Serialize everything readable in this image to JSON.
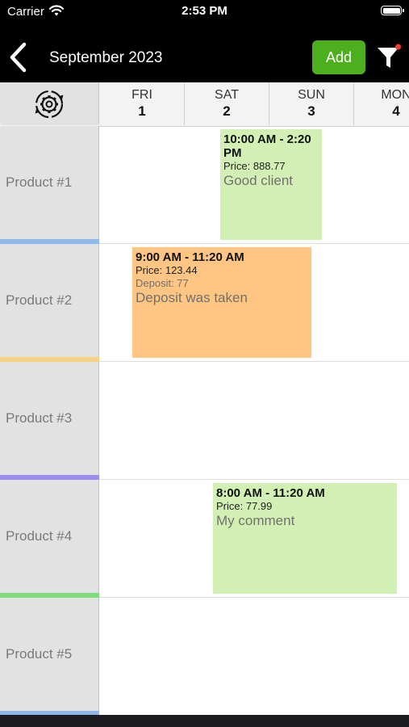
{
  "status_bar": {
    "carrier": "Carrier",
    "time": "2:53 PM"
  },
  "nav": {
    "title": "September 2023",
    "add_label": "Add",
    "back_icon": "chevron-left-icon",
    "filter_icon": "filter-icon"
  },
  "header": {
    "settings_icon": "gear-sync-icon",
    "days": [
      {
        "name": "FRI",
        "num": "1"
      },
      {
        "name": "SAT",
        "num": "2"
      },
      {
        "name": "SUN",
        "num": "3"
      },
      {
        "name": "MON",
        "num": "4"
      }
    ]
  },
  "products": [
    {
      "label": "Product #1",
      "color": "#8fb9ea"
    },
    {
      "label": "Product #2",
      "color": "#f7d27e"
    },
    {
      "label": "Product #3",
      "color": "#9e8cf0"
    },
    {
      "label": "Product #4",
      "color": "#7fdc7a"
    },
    {
      "label": "Product #5",
      "color": "#8fb9ea"
    }
  ],
  "events": [
    {
      "time": "10:00 AM - 2:20 PM",
      "price": "Price: 888.77",
      "deposit": "",
      "comment": "Good client",
      "color": "#d3f0b4"
    },
    {
      "time": "9:00 AM - 11:20 AM",
      "price": "Price: 123.44",
      "deposit": "Deposit: 77",
      "comment": "Deposit was taken",
      "color": "#ffc583"
    },
    {
      "time": "8:00 AM - 11:20 AM",
      "price": "Price: 77.99",
      "deposit": "",
      "comment": "My comment",
      "color": "#d3f0b4"
    }
  ]
}
